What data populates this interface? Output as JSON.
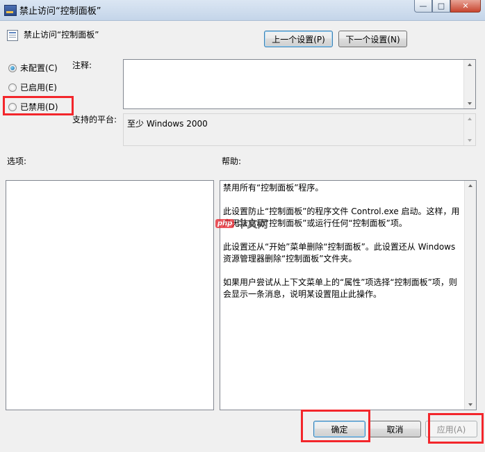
{
  "window": {
    "title": "禁止访问“控制面板”",
    "minimize_label": "—",
    "maximize_label": "□",
    "close_label": "✕"
  },
  "header": {
    "setting_name": "禁止访问“控制面板”",
    "prev_button": "上一个设置(P)",
    "next_button": "下一个设置(N)"
  },
  "state_options": [
    {
      "label": "未配置(C)",
      "selected": true
    },
    {
      "label": "已启用(E)",
      "selected": false
    },
    {
      "label": "已禁用(D)",
      "selected": false
    }
  ],
  "comment": {
    "label": "注释:",
    "value": ""
  },
  "platform": {
    "label": "支持的平台:",
    "value": "至少 Windows 2000"
  },
  "options": {
    "label": "选项:"
  },
  "help": {
    "label": "帮助:",
    "paragraphs": [
      "禁用所有“控制面板”程序。",
      "此设置防止“控制面板”的程序文件 Control.exe 启动。这样，用户无法启动“控制面板”或运行任何“控制面板”项。",
      "此设置还从“开始”菜单删除“控制面板”。此设置还从 Windows 资源管理器删除“控制面板”文件夹。",
      "如果用户尝试从上下文菜单上的“属性”项选择“控制面板”项，则会显示一条消息，说明某设置阻止此操作。"
    ]
  },
  "footer": {
    "ok_button": "确定",
    "cancel_button": "取消",
    "apply_button": "应用(A)"
  },
  "watermark": {
    "logo": "php",
    "text": "中文网"
  },
  "colors": {
    "highlight_red": "#f3262b",
    "window_bg": "#f0f0f0"
  }
}
